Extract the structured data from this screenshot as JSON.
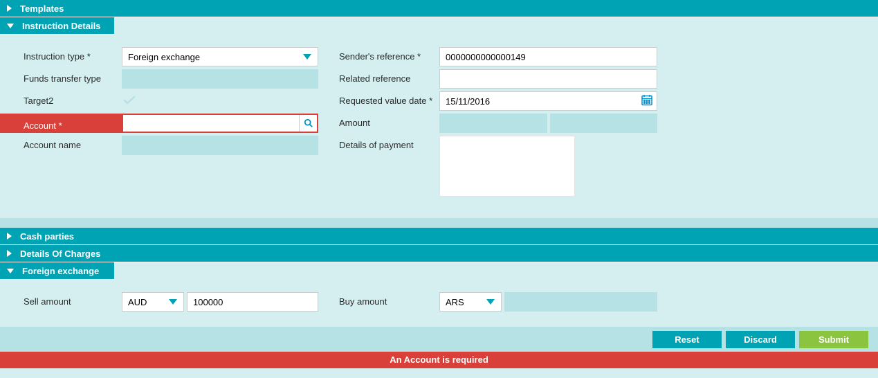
{
  "sections": {
    "templates": "Templates",
    "instruction_details": "Instruction Details",
    "cash_parties": "Cash parties",
    "details_of_charges": "Details Of Charges",
    "foreign_exchange": "Foreign exchange"
  },
  "labels": {
    "instruction_type": "Instruction type *",
    "funds_transfer_type": "Funds transfer type",
    "target2": "Target2",
    "account": "Account *",
    "account_name": "Account name",
    "senders_reference": "Sender's reference *",
    "related_reference": "Related reference",
    "requested_value_date": "Requested value date *",
    "amount": "Amount",
    "details_of_payment": "Details of payment",
    "sell_amount": "Sell amount",
    "buy_amount": "Buy amount"
  },
  "values": {
    "instruction_type": "Foreign exchange",
    "funds_transfer_type": "",
    "account": "",
    "account_name": "",
    "senders_reference": "0000000000000149",
    "related_reference": "",
    "requested_value_date": "15/11/2016",
    "amount_currency": "",
    "amount_value": "",
    "details_of_payment": "",
    "sell_currency": "AUD",
    "sell_amount": "100000",
    "buy_currency": "ARS",
    "buy_amount": ""
  },
  "buttons": {
    "reset": "Reset",
    "discard": "Discard",
    "submit": "Submit"
  },
  "error": "An Account is required"
}
